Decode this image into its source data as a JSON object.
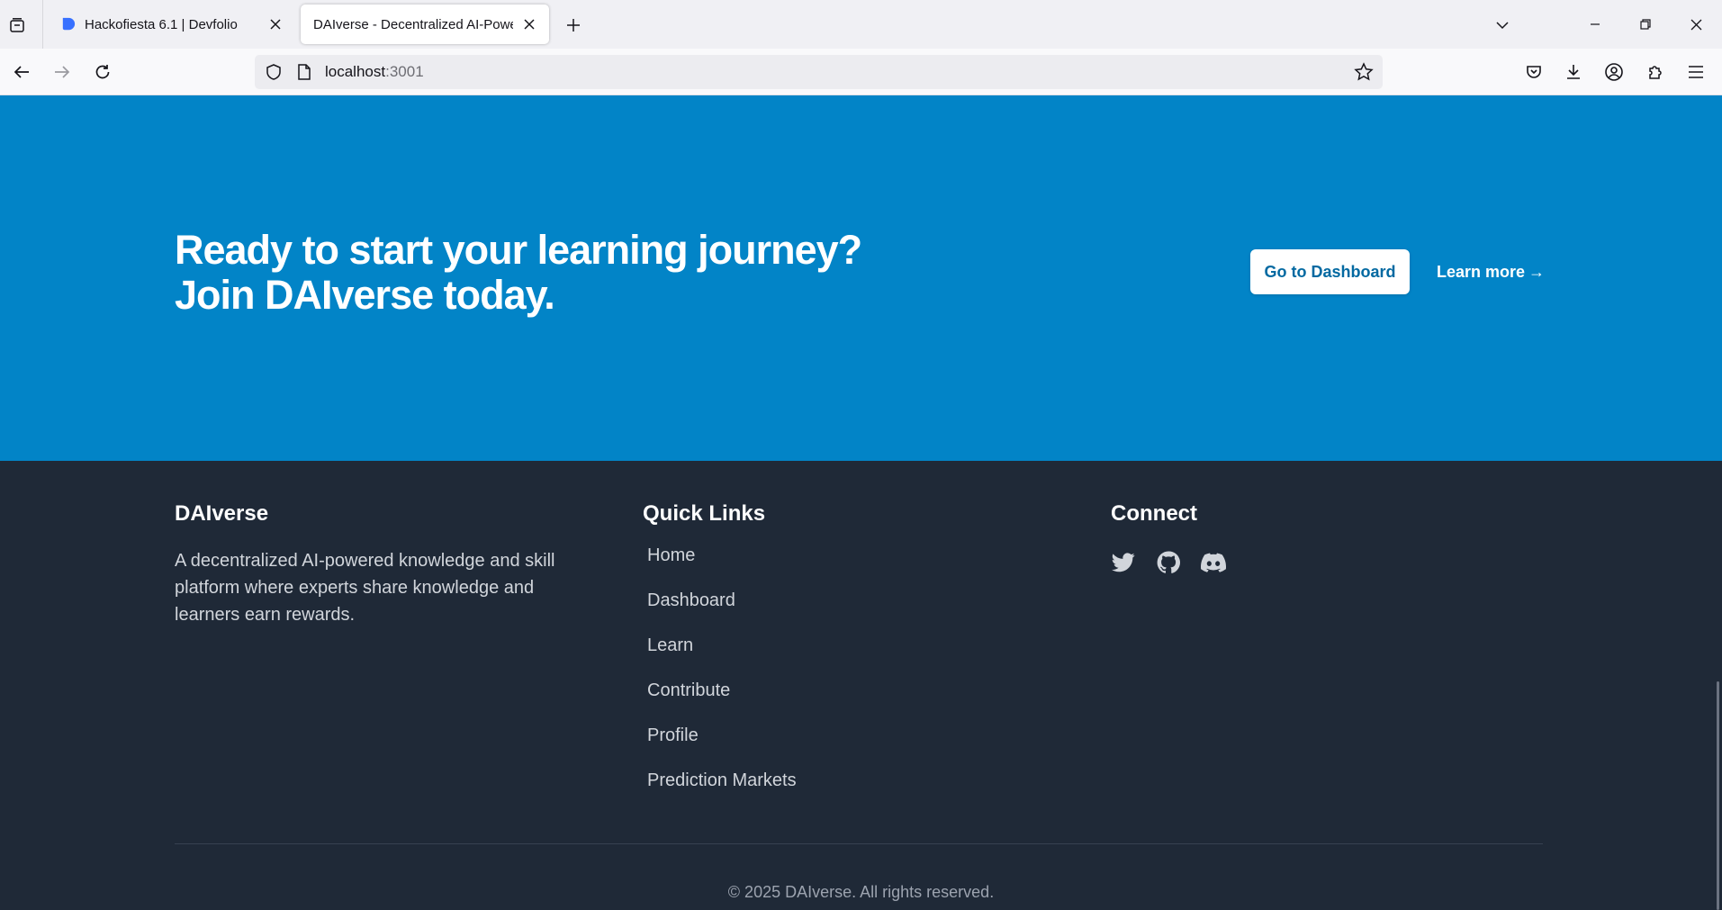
{
  "browser": {
    "tabs": [
      {
        "title": "Hackofiesta 6.1 | Devfolio",
        "active": false
      },
      {
        "title": "DAIverse - Decentralized AI-Powered",
        "active": true
      }
    ],
    "url": {
      "host": "localhost",
      "port": ":3001"
    }
  },
  "cta": {
    "heading_line1": "Ready to start your learning journey?",
    "heading_line2": "Join DAIverse today.",
    "primary_button": "Go to Dashboard",
    "secondary_link": "Learn more",
    "secondary_arrow": "→"
  },
  "footer": {
    "brand": {
      "name": "DAIverse",
      "description": "A decentralized AI-powered knowledge and skill platform where experts share knowledge and learners earn rewards."
    },
    "quick_links": {
      "heading": "Quick Links",
      "items": [
        "Home",
        "Dashboard",
        "Learn",
        "Contribute",
        "Profile",
        "Prediction Markets"
      ]
    },
    "connect": {
      "heading": "Connect",
      "icons": [
        "twitter-icon",
        "github-icon",
        "discord-icon"
      ]
    },
    "copyright": "© 2025 DAIverse. All rights reserved."
  },
  "colors": {
    "cta_bg": "#0284c7",
    "footer_bg": "#1f2937",
    "button_text": "#0369a1"
  }
}
